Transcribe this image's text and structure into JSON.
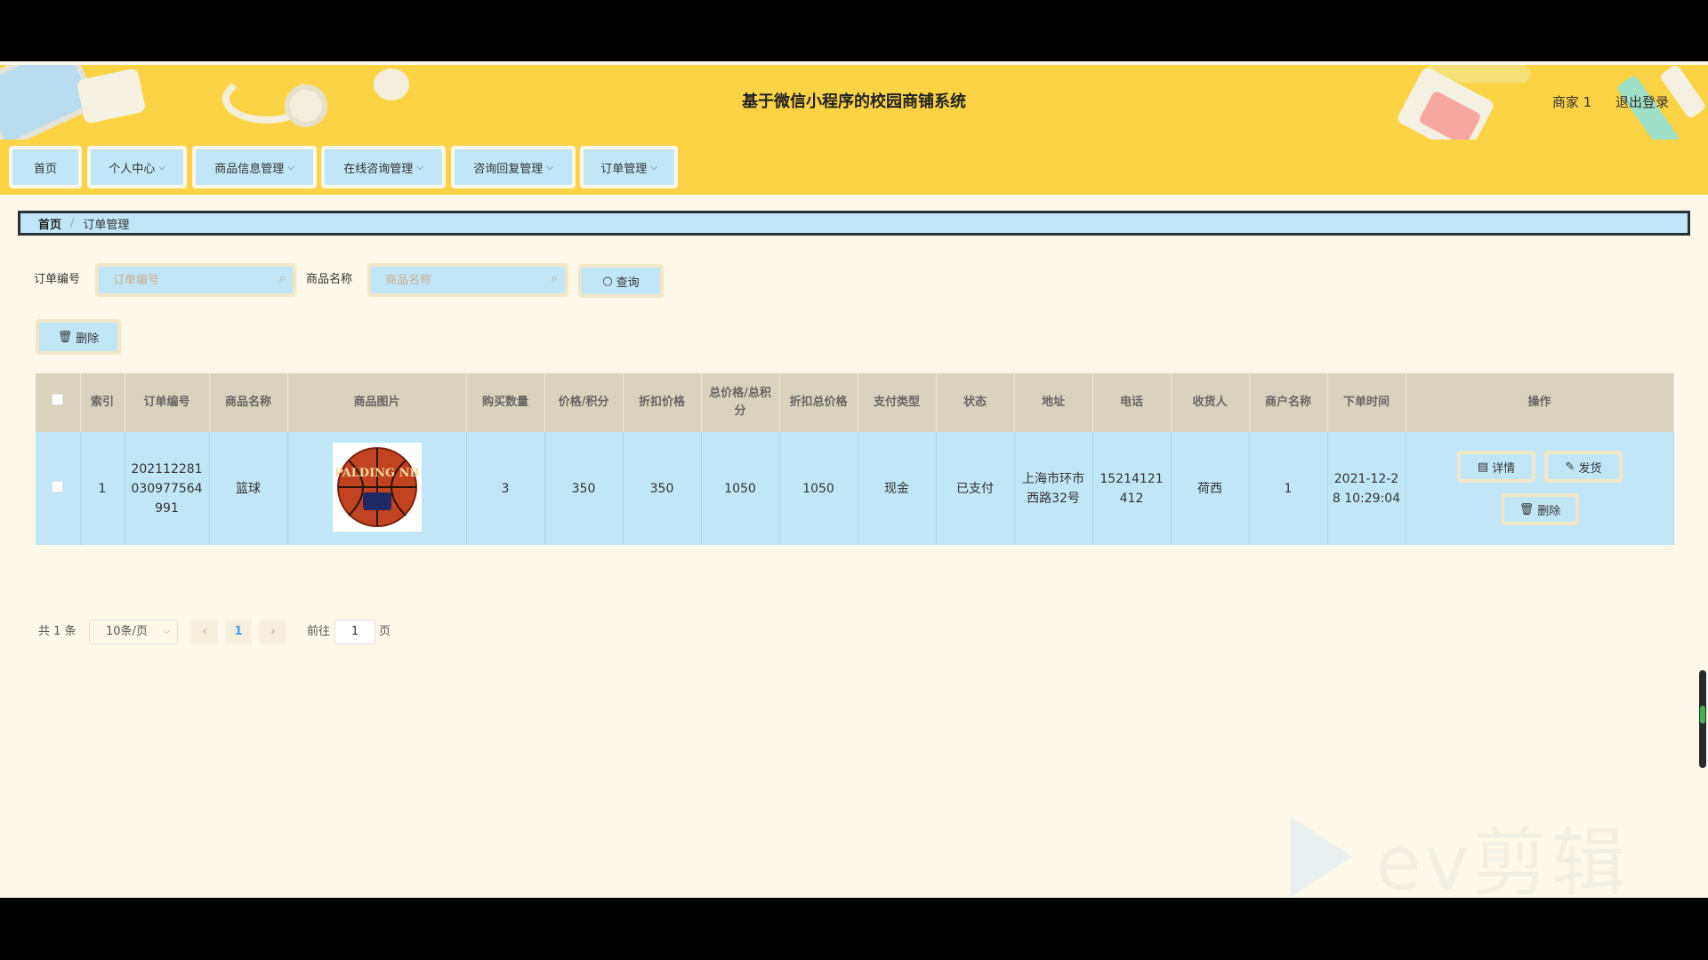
{
  "header": {
    "title": "基于微信小程序的校园商铺系统",
    "user": "商家 1",
    "logout": "退出登录"
  },
  "nav": [
    {
      "label": "首页",
      "dropdown": false
    },
    {
      "label": "个人中心",
      "dropdown": true
    },
    {
      "label": "商品信息管理",
      "dropdown": true
    },
    {
      "label": "在线咨询管理",
      "dropdown": true
    },
    {
      "label": "咨询回复管理",
      "dropdown": true
    },
    {
      "label": "订单管理",
      "dropdown": true
    }
  ],
  "breadcrumb": {
    "home": "首页",
    "current": "订单管理"
  },
  "search": {
    "order_label": "订单编号",
    "order_placeholder": "订单编号",
    "product_label": "商品名称",
    "product_placeholder": "商品名称",
    "query": "查询"
  },
  "actions": {
    "delete": "删除"
  },
  "table": {
    "columns": [
      "索引",
      "订单编号",
      "商品名称",
      "商品图片",
      "购买数量",
      "价格/积分",
      "折扣价格",
      "总价格/总积分",
      "折扣总价格",
      "支付类型",
      "状态",
      "地址",
      "电话",
      "收货人",
      "商户名称",
      "下单时间",
      "操作"
    ],
    "rows": [
      {
        "index": "1",
        "order_no": "202112281030977564991",
        "product": "篮球",
        "image_text": "SPALDING NBA",
        "qty": "3",
        "price": "350",
        "discount_price": "350",
        "total": "1050",
        "discount_total": "1050",
        "pay_type": "现金",
        "status": "已支付",
        "address": "上海市环市西路32号",
        "phone": "15214121412",
        "receiver": "荷西",
        "merchant": "1",
        "time": "2021-12-28 10:29:04"
      }
    ],
    "ops": {
      "detail": "详情",
      "ship": "发货",
      "delete": "删除"
    }
  },
  "pagination": {
    "total": "共 1 条",
    "page_size": "10条/页",
    "current": "1",
    "goto": "前往",
    "goto_value": "1",
    "page_unit": "页"
  },
  "watermark": "ev剪辑"
}
